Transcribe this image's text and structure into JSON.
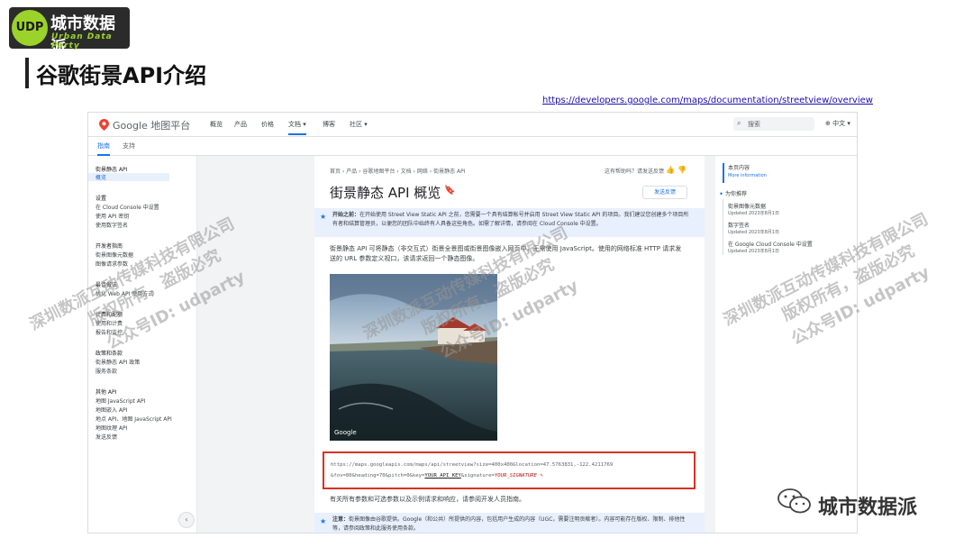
{
  "logo": {
    "title": "城市数据派",
    "subtitle": "Urban Data Party",
    "badge": "UDP"
  },
  "slide_title": "谷歌街景API介绍",
  "source_url": "https://developers.google.com/maps/documentation/streetview/overview",
  "topbar": {
    "brand": "Google 地图平台",
    "nav": [
      "概览",
      "产品",
      "价格",
      "文档 ▾",
      "博客",
      "社区 ▾"
    ],
    "search_placeholder": "搜索",
    "language": "中文 ▾"
  },
  "subtabs": [
    "指南",
    "支持"
  ],
  "left_nav": [
    {
      "text": "街景静态 API"
    },
    {
      "text": "概览"
    },
    {
      "text": "设置"
    },
    {
      "text": "在 Cloud Console 中设置"
    },
    {
      "text": "使用 API 密钥"
    },
    {
      "text": "使用数字签名"
    },
    {
      "text": "开发者指南"
    },
    {
      "text": "街景图像元数据"
    },
    {
      "text": "图像请求参数"
    },
    {
      "text": "最佳做法"
    },
    {
      "text": "优化 Web API 使用方式"
    },
    {
      "text": "计费和配额"
    },
    {
      "text": "使用和计费"
    },
    {
      "text": "报告和监控"
    },
    {
      "text": "政策和条款"
    },
    {
      "text": "街景静态 API 政策"
    },
    {
      "text": "服务条款"
    },
    {
      "text": "其他 API"
    },
    {
      "text": "地图 JavaScript API"
    },
    {
      "text": "地图嵌入 API"
    },
    {
      "text": "地点 API、地图 JavaScript API"
    },
    {
      "text": "地图纹理 API"
    },
    {
      "text": "发送反馈"
    }
  ],
  "content": {
    "breadcrumb": "首页 › 产品 › 谷歌地图平台 › 文档 › 网络 › 街景静态 API",
    "helpful": "这有帮助吗？请发送反馈",
    "heading": "街景静态 API 概览",
    "feedback": "发送反馈",
    "note1": {
      "label": "开始之前：",
      "text": "在开始使用 Street View Static API 之前，您需要一个具有结算帐号并启用 Street View Static API 的项目。我们建议您创建多个项目所有者和结算管理员，以便您的团队中始终有人具备这些角色。如需了解详情，请参阅在 Cloud Console 中设置。"
    },
    "paragraph": "街景静态 API 可将静态（非交互式）街景全景图或街景图像嵌入网页中，无需使用 JavaScript。使用的网络标准 HTTP 请求发送的 URL 参数定义视口，该请求返回一个静态图像。",
    "photo_watermark": "Google",
    "code_line1_prefix": "https://maps.googleapis.com/maps/api/streetview?size=400x400&location=47.5763831,-122.4211769",
    "code_line2_prefix": "&fov=80&heading=70&pitch=0&key=",
    "code_key": "YOUR_API_KEY",
    "code_sig_label": "&signature=",
    "code_sig": "YOUR_SIGNATURE",
    "after": "有关所有参数和可选参数以及示例请求和响应，请参阅开发人员指南。",
    "note2": {
      "label": "注意：",
      "text": "街景图像由谷歌提供。Google（和公共）所提供的内容，包括用户生成的内容（UGC，需要注明贡献者）。内容可能存在版权、限制、排他性等，请参阅政策和此服务使用条款。"
    }
  },
  "right_rail": {
    "title": "本页内容",
    "more": "More information",
    "section": "为你推荐",
    "items": [
      {
        "title": "街景图像元数据",
        "date": "Updated 2023年8月1日"
      },
      {
        "title": "数字签名",
        "date": "Updated 2023年8月1日"
      },
      {
        "title": "在 Google Cloud Console 中设置",
        "date": "Updated 2023年8月1日"
      }
    ]
  },
  "watermark": {
    "line1": "深圳数派互动传媒科技有限公司",
    "line2": "版权所有，盗版必究",
    "line3": "公众号ID: udparty"
  },
  "footer_brand": "城市数据派",
  "colors": {
    "accent": "#1a73e8",
    "note_bg": "#e8f0fe",
    "highlight_border": "#d93025",
    "logo_green": "#9bd32a"
  }
}
